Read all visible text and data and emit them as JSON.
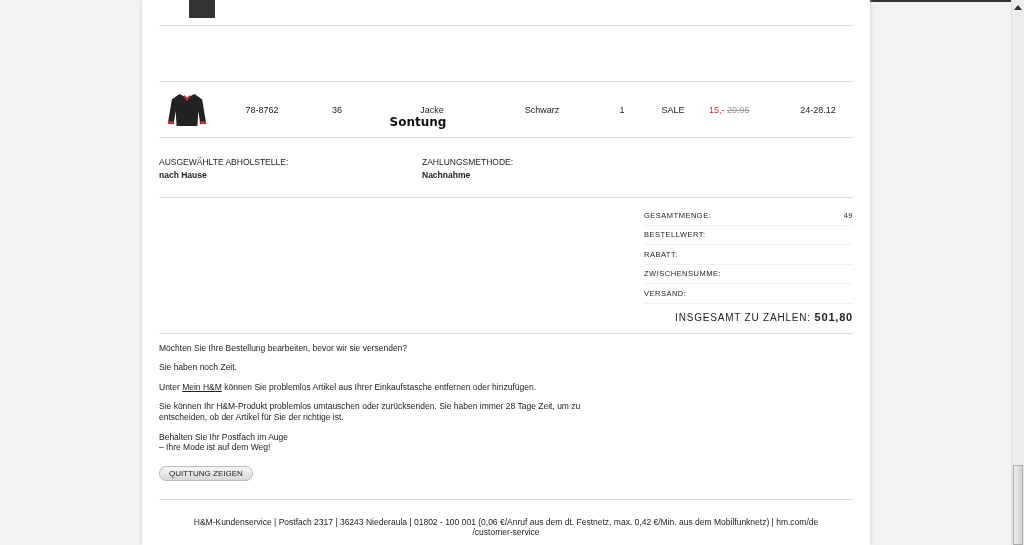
{
  "order_rows": [
    {
      "article": "78-8762",
      "size": "36",
      "name": "Jacke",
      "note": "Sontung",
      "colour_name": "Schwarz",
      "quantity": "1",
      "tag": "SALE",
      "price": "15,-",
      "old_price": "29,95",
      "delivery": "24-28.12"
    }
  ],
  "pickup": {
    "label": "AUSGEWÄHLTE ABHOLSTELLE:",
    "value": "nach Hause"
  },
  "payment": {
    "label": "ZAHLUNGSMETHODE:",
    "value": "Nachnahme"
  },
  "summary": [
    {
      "label": "GESAMTMENGE:",
      "value": "49"
    },
    {
      "label": "BESTELLWERT:"
    },
    {
      "label": "RABATT:"
    },
    {
      "label": "ZWISCHENSUMME:"
    },
    {
      "label": "VERSAND:"
    }
  ],
  "total": {
    "label": "INSGESAMT ZU ZAHLEN:",
    "value": "501,80"
  },
  "info": {
    "question": "Möchten Sie Ihre Bestellung bearbeiten, bevor wir sie versenden?",
    "time": "Sie haben noch Zeit.",
    "link_before": "Unter",
    "link": "Mein H&M",
    "link_after": "können Sie problemlos Artikel aus Ihrer Einkaufstasche entfernen oder hinzufügen.",
    "returns": "Sie können Ihr H&M-Produkt problemlos umtauschen oder zurücksenden. Sie haben immer 28 Tage Zeit, um zu entscheiden, ob der Artikel für Sie der richtige ist.",
    "mailbox": [
      "Behalten Sie Ihr Postfach im Auge",
      "– Ihre Mode ist auf dem Weg!"
    ]
  },
  "receipt_button": "QUITTUNG ZEIGEN",
  "footer": [
    "H&M-Kundenservice | Postfach 2317 | 36243 Niederaula | 01802 - 100 001 (0,06 €/Anruf aus dem dt. Festnetz, max. 0,42 €/Min. aus dem Mobilfunknetz) | hm.com/de",
    "/customer-service"
  ]
}
